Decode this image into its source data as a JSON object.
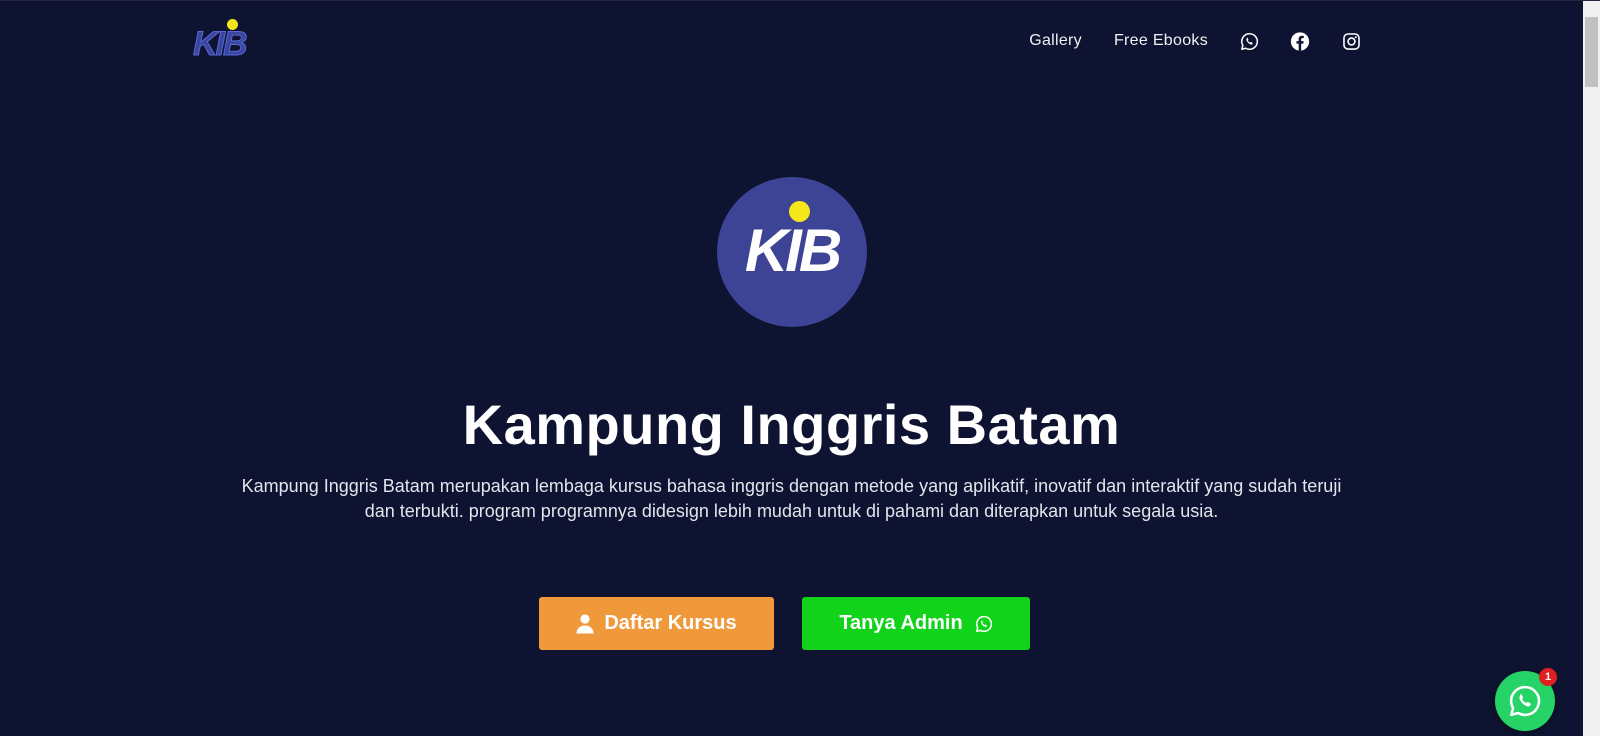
{
  "header": {
    "logo_text": "KIB",
    "nav": [
      {
        "label": "Gallery"
      },
      {
        "label": "Free Ebooks"
      }
    ],
    "social_icons": [
      "whatsapp-icon",
      "facebook-icon",
      "instagram-icon"
    ]
  },
  "hero": {
    "logo_text": "KIB",
    "title": "Kampung Inggris Batam",
    "description": "Kampung Inggris Batam merupakan lembaga kursus bahasa inggris dengan metode yang aplikatif, inovatif dan interaktif yang sudah teruji dan terbukti. program programnya didesign lebih mudah untuk di pahami dan diterapkan untuk segala usia.",
    "buttons": {
      "daftar": {
        "label": "Daftar Kursus",
        "icon": "user-icon"
      },
      "tanya": {
        "label": "Tanya Admin",
        "icon": "whatsapp-icon"
      }
    }
  },
  "floating_chat": {
    "icon": "whatsapp-icon",
    "badge_count": "1"
  },
  "colors": {
    "background": "#0d1330",
    "logo_circle": "#3d4495",
    "logo_dot": "#f6e71a",
    "daftar_button": "#f0993b",
    "tanya_button": "#11d31a",
    "whatsapp_green": "#25d366",
    "badge_red": "#e02020"
  }
}
